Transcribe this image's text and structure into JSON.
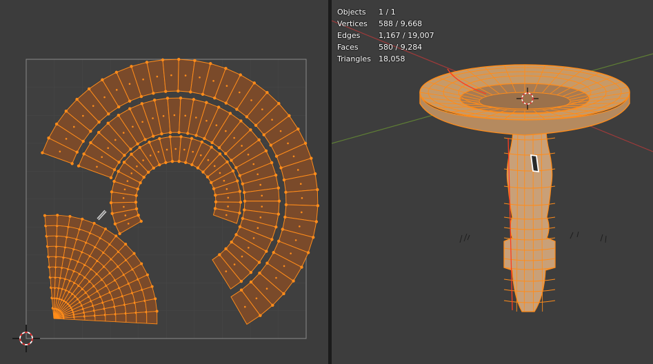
{
  "colors": {
    "uv_background": "#3c3c3c",
    "viewport_background": "#3d3d3d",
    "selection_orange": "#ff8c1a",
    "face_fill": "#7a4a2a",
    "x_axis_red": "#a03a3a",
    "y_axis_green": "#5f7f35"
  },
  "icons": {
    "uv_cursor": "2d-cursor-icon",
    "viewport_cursor": "3d-cursor-icon"
  },
  "viewport": {
    "stats": [
      {
        "label": "Objects",
        "value": "1 / 1"
      },
      {
        "label": "Vertices",
        "value": "588 / 9,668"
      },
      {
        "label": "Edges",
        "value": "1,167 / 19,007"
      },
      {
        "label": "Faces",
        "value": "580 / 9,284"
      },
      {
        "label": "Triangles",
        "value": "18,058"
      }
    ]
  }
}
